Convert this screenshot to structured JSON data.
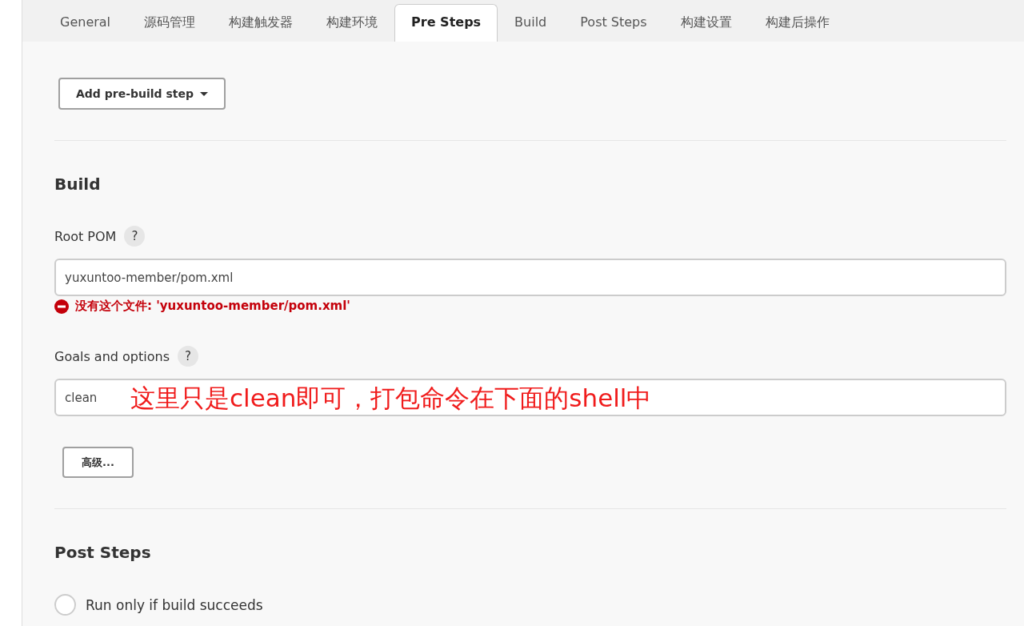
{
  "tabs": [
    {
      "label": "General",
      "selected": false
    },
    {
      "label": "源码管理",
      "selected": false
    },
    {
      "label": "构建触发器",
      "selected": false
    },
    {
      "label": "构建环境",
      "selected": false
    },
    {
      "label": "Pre Steps",
      "selected": true
    },
    {
      "label": "Build",
      "selected": false
    },
    {
      "label": "Post Steps",
      "selected": false
    },
    {
      "label": "构建设置",
      "selected": false
    },
    {
      "label": "构建后操作",
      "selected": false
    }
  ],
  "pre_steps": {
    "add_button": "Add pre-build step"
  },
  "build": {
    "title": "Build",
    "root_pom": {
      "label": "Root POM",
      "help": "?",
      "value": "yuxuntoo-member/pom.xml",
      "error": "没有这个文件: 'yuxuntoo-member/pom.xml'"
    },
    "goals": {
      "label": "Goals and options",
      "help": "?",
      "value": "clean",
      "annotation": "这里只是clean即可，打包命令在下面的shell中"
    },
    "advanced_button": "高级..."
  },
  "post_steps": {
    "title": "Post Steps",
    "options": [
      {
        "label": "Run only if build succeeds",
        "selected": false
      }
    ]
  }
}
